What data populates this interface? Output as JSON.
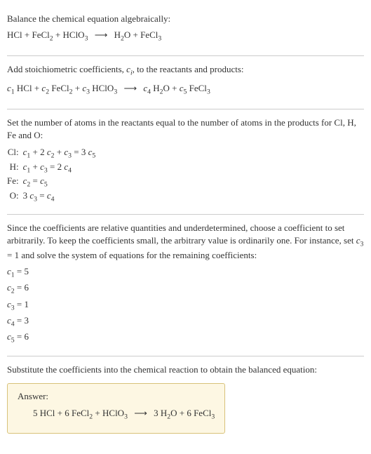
{
  "sec1": {
    "title": "Balance the chemical equation algebraically:",
    "eq_parts": {
      "t1": "HCl + FeCl",
      "s1": "2",
      "t2": " + HClO",
      "s2": "3",
      "arrow": "⟶",
      "t3": "H",
      "s3": "2",
      "t4": "O + FeCl",
      "s4": "3"
    }
  },
  "sec2": {
    "line1a": "Add stoichiometric coefficients, ",
    "line1_ci": "c",
    "line1_i": "i",
    "line1b": ", to the reactants and products:",
    "eq": {
      "c1": "c",
      "n1": "1",
      "t1": " HCl + ",
      "c2": "c",
      "n2": "2",
      "t2": " FeCl",
      "s2": "2",
      "t2b": " + ",
      "c3": "c",
      "n3": "3",
      "t3": " HClO",
      "s3": "3",
      "arrow": "⟶",
      "c4": "c",
      "n4": "4",
      "t4": " H",
      "s4": "2",
      "t4b": "O + ",
      "c5": "c",
      "n5": "5",
      "t5": " FeCl",
      "s5": "3"
    }
  },
  "sec3": {
    "intro": "Set the number of atoms in the reactants equal to the number of atoms in the products for Cl, H, Fe and O:",
    "rows": [
      {
        "el": "Cl:",
        "lhs_a": "c",
        "lhs_as": "1",
        "lhs_b": " + 2 ",
        "lhs_c": "c",
        "lhs_cs": "2",
        "lhs_d": " + ",
        "lhs_e": "c",
        "lhs_es": "3",
        "eq": " = 3 ",
        "rhs_a": "c",
        "rhs_as": "5"
      },
      {
        "el": "H:",
        "lhs_a": "c",
        "lhs_as": "1",
        "lhs_b": " + ",
        "lhs_c": "c",
        "lhs_cs": "3",
        "eq": " = 2 ",
        "rhs_a": "c",
        "rhs_as": "4"
      },
      {
        "el": "Fe:",
        "lhs_a": "c",
        "lhs_as": "2",
        "eq": " = ",
        "rhs_a": "c",
        "rhs_as": "5"
      },
      {
        "el": "O:",
        "pre": "3 ",
        "lhs_a": "c",
        "lhs_as": "3",
        "eq": " = ",
        "rhs_a": "c",
        "rhs_as": "4"
      }
    ]
  },
  "sec4": {
    "para_a": "Since the coefficients are relative quantities and underdetermined, choose a coefficient to set arbitrarily. To keep the coefficients small, the arbitrary value is ordinarily one. For instance, set ",
    "para_c": "c",
    "para_cs": "3",
    "para_b": " = 1 and solve the system of equations for the remaining coefficients:",
    "coeffs": [
      {
        "c": "c",
        "s": "1",
        "v": " = 5"
      },
      {
        "c": "c",
        "s": "2",
        "v": " = 6"
      },
      {
        "c": "c",
        "s": "3",
        "v": " = 1"
      },
      {
        "c": "c",
        "s": "4",
        "v": " = 3"
      },
      {
        "c": "c",
        "s": "5",
        "v": " = 6"
      }
    ]
  },
  "sec5": {
    "line": "Substitute the coefficients into the chemical reaction to obtain the balanced equation:",
    "answer_label": "Answer:",
    "eq": {
      "t1": "5 HCl + 6 FeCl",
      "s1": "2",
      "t2": " + HClO",
      "s2": "3",
      "arrow": "⟶",
      "t3": "3 H",
      "s3": "2",
      "t4": "O + 6 FeCl",
      "s4": "3"
    }
  }
}
